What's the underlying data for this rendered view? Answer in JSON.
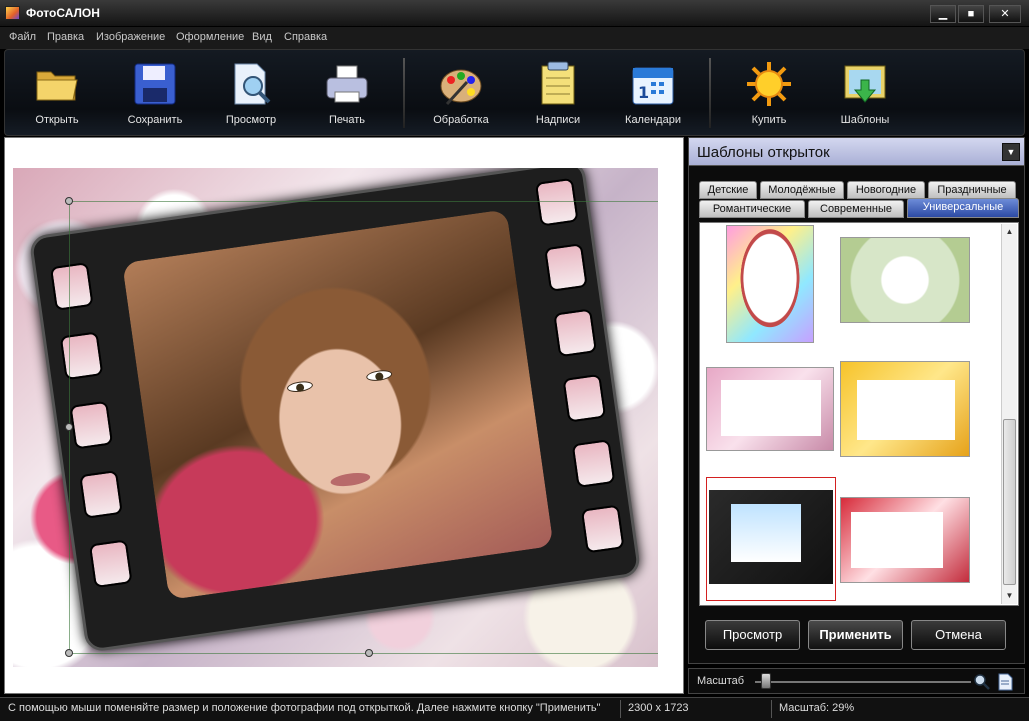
{
  "window": {
    "title": "ФотоСАЛОН",
    "minimize": "▁",
    "maximize": "■",
    "close": "✕"
  },
  "menu": [
    "Файл",
    "Правка",
    "Изображение",
    "Оформление",
    "Вид",
    "Справка"
  ],
  "toolbar": {
    "items": [
      {
        "label": "Открыть",
        "icon": "open-folder-icon"
      },
      {
        "label": "Сохранить",
        "icon": "save-disk-icon"
      },
      {
        "label": "Просмотр",
        "icon": "preview-magnifier-icon"
      },
      {
        "label": "Печать",
        "icon": "printer-icon"
      },
      {
        "label": "Обработка",
        "icon": "palette-icon"
      },
      {
        "label": "Надписи",
        "icon": "notepad-icon"
      },
      {
        "label": "Календари",
        "icon": "calendar-icon"
      },
      {
        "label": "Купить",
        "icon": "sun-icon"
      },
      {
        "label": "Шаблоны",
        "icon": "templates-download-icon"
      }
    ]
  },
  "panel": {
    "title": "Шаблоны открыток",
    "tabs_row1": [
      "Детские",
      "Молодёжные",
      "Новогодние",
      "Праздничные"
    ],
    "tabs_row2": [
      "Романтические",
      "Современные",
      "Универсальные"
    ],
    "active_tab": "Универсальные",
    "buttons": {
      "preview": "Просмотр",
      "apply": "Применить",
      "cancel": "Отмена"
    }
  },
  "zoom": {
    "label": "Масштаб",
    "level": 0.04
  },
  "status": {
    "hint": "С помощью мыши поменяйте размер и положение фотографии под открыткой. Далее нажмите кнопку \"Применить\"",
    "dimensions": "2300 x 1723",
    "zoom_text": "Масштаб: 29%"
  },
  "colors": {
    "accent_tab": "#2c4aa4",
    "selected_border": "#d32020",
    "panel_header": "#c4c9e8"
  }
}
